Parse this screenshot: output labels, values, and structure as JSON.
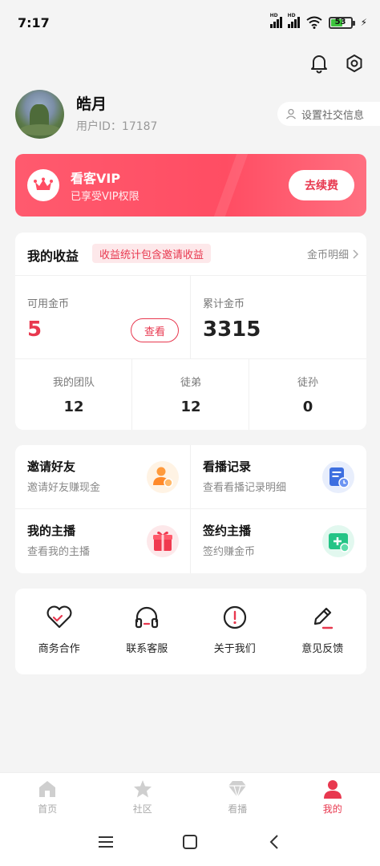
{
  "status_bar": {
    "time": "7:17",
    "battery": "53",
    "signal_label": "HD"
  },
  "profile": {
    "name": "皓月",
    "user_id": "用户ID：17187",
    "social_btn": "设置社交信息"
  },
  "vip": {
    "title": "看客VIP",
    "subtitle": "已享受VIP权限",
    "button": "去续费"
  },
  "earnings": {
    "title": "我的收益",
    "tag": "收益统计包含邀请收益",
    "detail_link": "金币明细",
    "available_label": "可用金币",
    "available_value": "5",
    "view_button": "查看",
    "total_label": "累计金币",
    "total_value": "3315",
    "team": [
      {
        "label": "我的团队",
        "value": "12"
      },
      {
        "label": "徒弟",
        "value": "12"
      },
      {
        "label": "徒孙",
        "value": "0"
      }
    ]
  },
  "features": [
    {
      "title": "邀请好友",
      "subtitle": "邀请好友赚现金",
      "icon": "invite-user-icon"
    },
    {
      "title": "看播记录",
      "subtitle": "查看看播记录明细",
      "icon": "history-record-icon"
    },
    {
      "title": "我的主播",
      "subtitle": "查看我的主播",
      "icon": "gift-box-icon"
    },
    {
      "title": "签约主播",
      "subtitle": "签约赚金币",
      "icon": "sign-contract-icon"
    }
  ],
  "tools": [
    {
      "label": "商务合作",
      "icon": "heart-handshake-icon"
    },
    {
      "label": "联系客服",
      "icon": "headphones-icon"
    },
    {
      "label": "关于我们",
      "icon": "info-circle-icon"
    },
    {
      "label": "意见反馈",
      "icon": "pencil-feedback-icon"
    }
  ],
  "nav": [
    {
      "label": "首页",
      "icon": "home-icon"
    },
    {
      "label": "社区",
      "icon": "star-icon"
    },
    {
      "label": "看播",
      "icon": "diamond-icon"
    },
    {
      "label": "我的",
      "icon": "person-icon"
    }
  ],
  "colors": {
    "accent": "#e8384f",
    "vip_gradient_start": "#ff5a6e",
    "background": "#f4f4f4"
  }
}
